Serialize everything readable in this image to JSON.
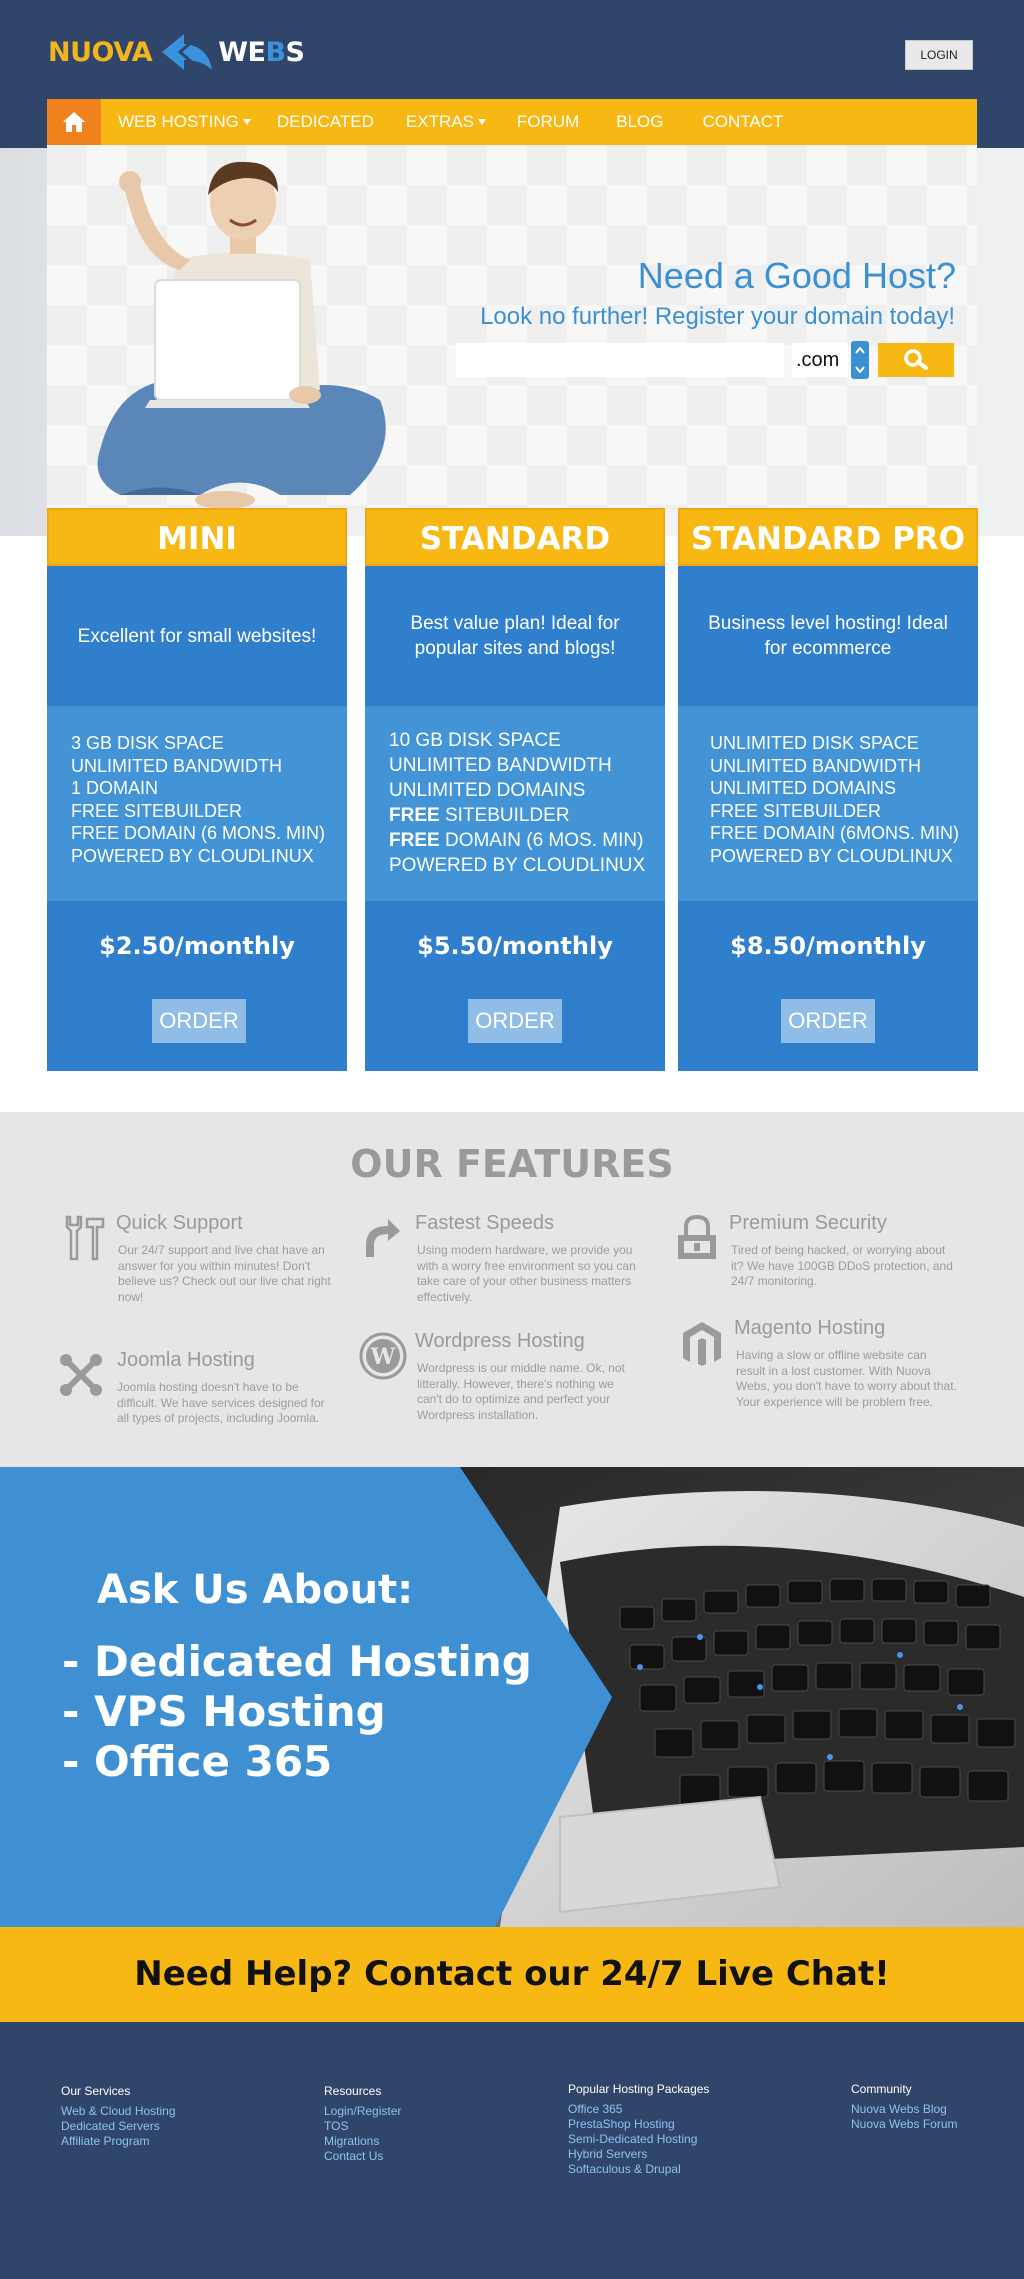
{
  "header": {
    "logo": {
      "left": "NUOVA",
      "right_prefix": "WE",
      "right_accent": "B",
      "right_suffix": "S"
    },
    "login_label": "LOGIN"
  },
  "nav": {
    "items": [
      {
        "label": "WEB HOSTING",
        "dropdown": true
      },
      {
        "label": "DEDICATED",
        "dropdown": false
      },
      {
        "label": "EXTRAS",
        "dropdown": true
      },
      {
        "label": "FORUM",
        "dropdown": false
      },
      {
        "label": "BLOG",
        "dropdown": false
      },
      {
        "label": "CONTACT",
        "dropdown": false
      }
    ]
  },
  "hero": {
    "title": "Need a Good Host?",
    "subtitle": "Look no further! Register your domain today!",
    "domain_value": "",
    "tld": ".com"
  },
  "plans": [
    {
      "name": "MINI",
      "description": "Excellent for small websites!",
      "features": [
        {
          "bold": "",
          "text": "3 GB DISK SPACE"
        },
        {
          "bold": "",
          "text": "UNLIMITED BANDWIDTH"
        },
        {
          "bold": "",
          "text": "1 DOMAIN"
        },
        {
          "bold": "",
          "text": "FREE SITEBUILDER"
        },
        {
          "bold": "",
          "text": "FREE DOMAIN (6 MONS. MIN)"
        },
        {
          "bold": "",
          "text": "POWERED BY CLOUDLINUX"
        }
      ],
      "price": "$2.50/monthly",
      "order_label": "ORDER"
    },
    {
      "name": "STANDARD",
      "description": "Best value plan! Ideal for popular sites and blogs!",
      "features": [
        {
          "bold": "",
          "text": "10 GB DISK SPACE"
        },
        {
          "bold": "",
          "text": "UNLIMITED BANDWIDTH"
        },
        {
          "bold": "",
          "text": "UNLIMITED DOMAINS"
        },
        {
          "bold": "FREE",
          "text": " SITEBUILDER"
        },
        {
          "bold": "FREE",
          "text": " DOMAIN (6 MOS. MIN)"
        },
        {
          "bold": "",
          "text": "POWERED BY CLOUDLINUX"
        }
      ],
      "price": "$5.50/monthly",
      "order_label": "ORDER"
    },
    {
      "name": "STANDARD PRO",
      "description": "Business level hosting! Ideal for ecommerce",
      "features": [
        {
          "bold": "",
          "text": "UNLIMITED DISK SPACE"
        },
        {
          "bold": "",
          "text": "UNLIMITED BANDWIDTH"
        },
        {
          "bold": "",
          "text": "UNLIMITED DOMAINS"
        },
        {
          "bold": "",
          "text": "FREE SITEBUILDER"
        },
        {
          "bold": "",
          "text": "FREE DOMAIN (6MONS. MIN)"
        },
        {
          "bold": "",
          "text": "POWERED BY CLOUDLINUX"
        }
      ],
      "price": "$8.50/monthly",
      "order_label": "ORDER"
    }
  ],
  "features": {
    "title": "OUR FEATURES",
    "items": [
      {
        "icon": "tools-icon",
        "title": "Quick Support",
        "text": "Our 24/7 support and live chat have an answer for you within minutes! Don't believe us? Check out our live chat right now!"
      },
      {
        "icon": "redo-arrow-icon",
        "title": "Fastest Speeds",
        "text": "Using modern hardware, we provide you with a worry free environment so you can take care of your other business matters effectively."
      },
      {
        "icon": "lock-icon",
        "title": "Premium Security",
        "text": "Tired of being hacked, or worrying about it? We have 100GB DDoS protection, and 24/7 monitoring."
      },
      {
        "icon": "joomla-icon",
        "title": "Joomla Hosting",
        "text": "Joomla hosting doesn't have to be difficult. We have services designed for all types of projects, including Joomla."
      },
      {
        "icon": "wordpress-icon",
        "title": "Wordpress Hosting",
        "text": "Wordpress is our middle name. Ok, not litterally. However, there's nothing we can't do to optimize and perfect your Wordpress installation."
      },
      {
        "icon": "magento-icon",
        "title": "Magento Hosting",
        "text": "Having a slow or offline website can result in a lost customer. With Nuova Webs, you don't have to worry about that. Your experience will be problem free."
      }
    ]
  },
  "ask": {
    "title": "Ask Us About:",
    "lines": [
      "- Dedicated Hosting",
      "- VPS Hosting",
      "- Office 365"
    ]
  },
  "help": {
    "text": "Need Help? Contact our 24/7 Live Chat!"
  },
  "footer": {
    "columns": [
      {
        "heading": "Our Services",
        "links": [
          "Web & Cloud Hosting",
          "Dedicated Servers",
          "Affiliate Program"
        ]
      },
      {
        "heading": "Resources",
        "links": [
          "Login/Register",
          "TOS",
          "Migrations",
          "Contact Us"
        ]
      },
      {
        "heading": "Popular Hosting Packages",
        "links": [
          "Office 365",
          "PrestaShop Hosting",
          "Semi-Dedicated Hosting",
          "Hybrid Servers",
          "Softaculous & Drupal"
        ]
      },
      {
        "heading": "Community",
        "links": [
          "Nuova Webs Blog",
          "Nuova Webs Forum"
        ]
      }
    ]
  },
  "colors": {
    "navy": "#2f4569",
    "yellow": "#f7b814",
    "orange": "#f0821e",
    "blue": "#2f7fcc",
    "light_blue": "#4394d7",
    "link_blue": "#8fc3f0"
  }
}
